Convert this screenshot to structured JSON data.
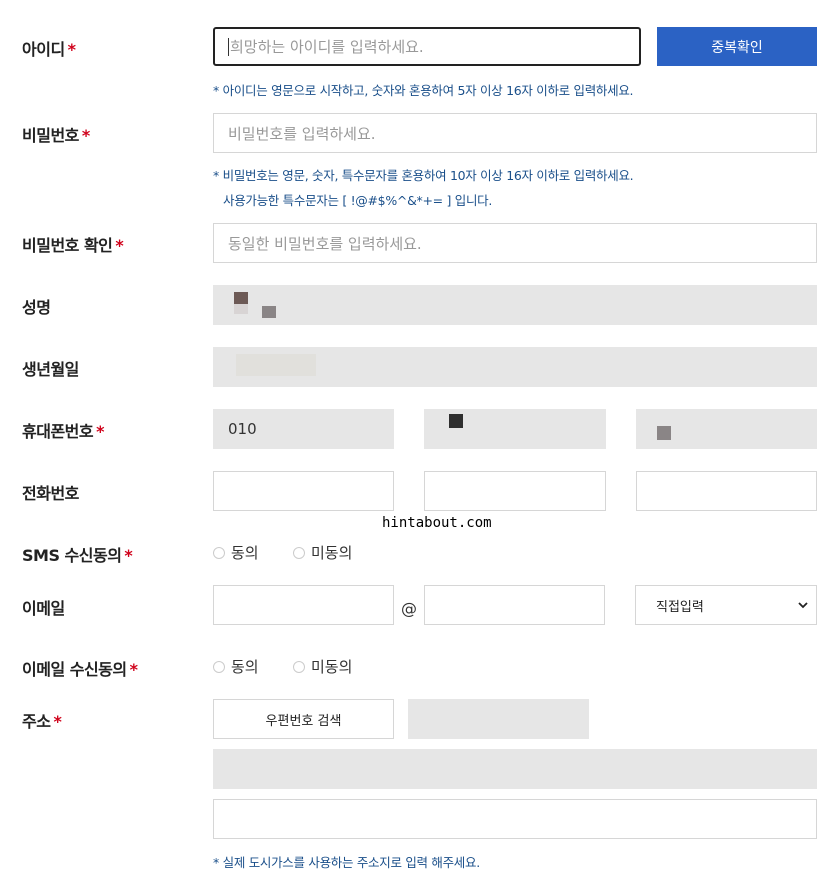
{
  "fields": {
    "id": {
      "label": "아이디",
      "required_mark": "*",
      "placeholder": "희망하는 아이디를 입력하세요.",
      "check_button": "중복확인",
      "hint": "* 아이디는 영문으로 시작하고, 숫자와 혼용하여 5자 이상 16자 이하로 입력하세요."
    },
    "password": {
      "label": "비밀번호",
      "required_mark": "*",
      "placeholder": "비밀번호를 입력하세요.",
      "hint_line1": "* 비밀번호는 영문, 숫자, 특수문자를 혼용하여 10자 이상 16자 이하로 입력하세요.",
      "hint_line2": "사용가능한 특수문자는 [ !@#$%^&*+= ] 입니다."
    },
    "password_confirm": {
      "label": "비밀번호 확인",
      "required_mark": "*",
      "placeholder": "동일한 비밀번호를 입력하세요."
    },
    "name": {
      "label": "성명"
    },
    "birth": {
      "label": "생년월일"
    },
    "mobile": {
      "label": "휴대폰번호",
      "required_mark": "*",
      "prefix": "010"
    },
    "phone": {
      "label": "전화번호"
    },
    "sms_consent": {
      "label": "SMS 수신동의",
      "required_mark": "*",
      "agree": "동의",
      "disagree": "미동의"
    },
    "email": {
      "label": "이메일",
      "at": "@",
      "domain_select": "직접입력"
    },
    "email_consent": {
      "label": "이메일 수신동의",
      "required_mark": "*",
      "agree": "동의",
      "disagree": "미동의"
    },
    "address": {
      "label": "주소",
      "required_mark": "*",
      "zip_button": "우편번호 검색",
      "hint": "* 실제 도시가스를 사용하는 주소지로 입력 해주세요."
    }
  },
  "watermark": "hintabout.com",
  "colors": {
    "accent": "#2b62c4",
    "required": "#d0021b",
    "hint": "#1a4f8a",
    "disabled": "#e6e6e6"
  }
}
